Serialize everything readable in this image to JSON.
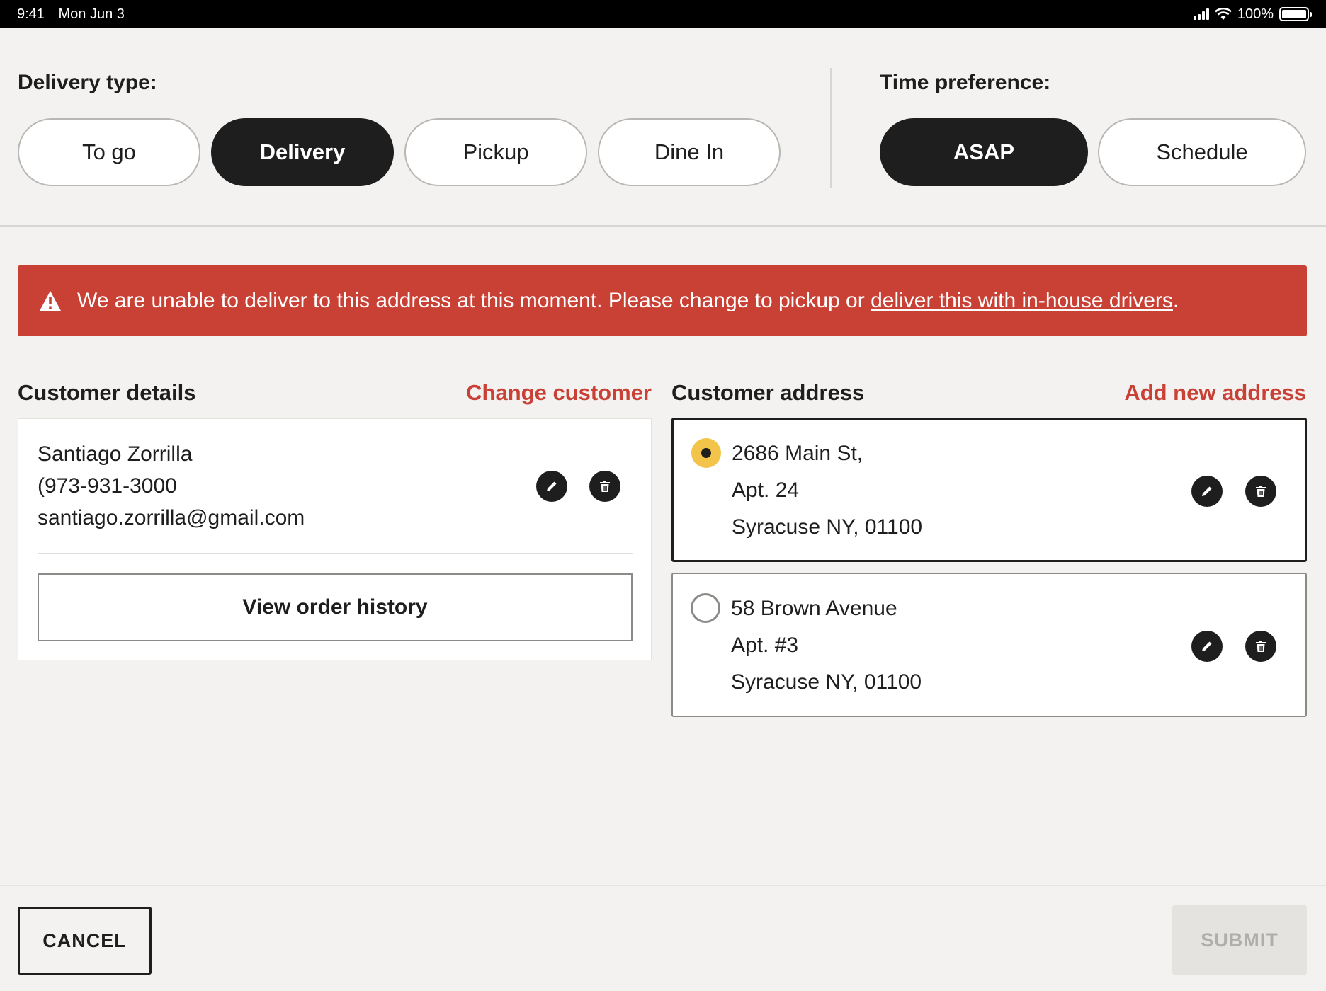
{
  "status_bar": {
    "time": "9:41",
    "date": "Mon Jun 3",
    "battery": "100%"
  },
  "delivery_type": {
    "label": "Delivery type:",
    "options": [
      "To go",
      "Delivery",
      "Pickup",
      "Dine In"
    ],
    "selected": "Delivery"
  },
  "time_preference": {
    "label": "Time preference:",
    "options": [
      "ASAP",
      "Schedule"
    ],
    "selected": "ASAP"
  },
  "alert": {
    "text": "We are unable to deliver to this address at this moment. Please change to pickup or ",
    "link_text": "deliver this with in-house drivers",
    "suffix": ".",
    "color": "#c94034"
  },
  "customer_details": {
    "title": "Customer details",
    "action": "Change customer",
    "name": "Santiago Zorrilla",
    "phone": "(973-931-3000",
    "email": "santiago.zorrilla@gmail.com",
    "history_button": "View order history"
  },
  "customer_address": {
    "title": "Customer address",
    "action": "Add new address",
    "addresses": [
      {
        "line1": "2686 Main St,",
        "line2": "Apt. 24",
        "line3": "Syracuse NY, 01100",
        "selected": true
      },
      {
        "line1": "58 Brown Avenue",
        "line2": "Apt. #3",
        "line3": "Syracuse NY, 01100",
        "selected": false
      }
    ]
  },
  "footer": {
    "cancel": "CANCEL",
    "submit": "SUBMIT"
  },
  "colors": {
    "accent": "#c94034",
    "dark": "#1e1e1e",
    "radio_selected": "#f3c44a",
    "background": "#f3f2f0"
  }
}
